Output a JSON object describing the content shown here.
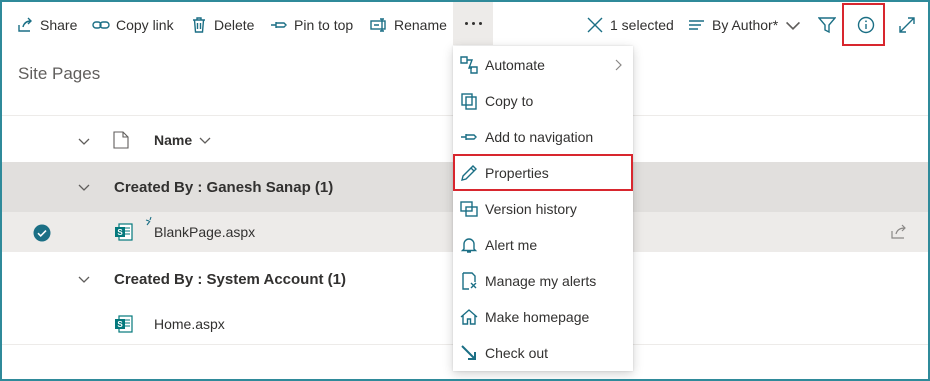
{
  "command_bar": {
    "share": "Share",
    "copy_link": "Copy link",
    "delete": "Delete",
    "pin_to_top": "Pin to top",
    "rename": "Rename",
    "selected": "1 selected",
    "view": "By Author*"
  },
  "page_title": "Site Pages",
  "column": {
    "name": "Name"
  },
  "groups": [
    {
      "title": "Created By : Ganesh Sanap (1)",
      "files": [
        "BlankPage.aspx"
      ]
    },
    {
      "title": "Created By : System Account (1)",
      "files": [
        "Home.aspx"
      ]
    }
  ],
  "context_menu": {
    "items": [
      {
        "label": "Automate",
        "icon": "automate-icon",
        "submenu": true
      },
      {
        "label": "Copy to",
        "icon": "copy-icon"
      },
      {
        "label": "Add to navigation",
        "icon": "pin-icon"
      },
      {
        "label": "Properties",
        "icon": "pencil-icon",
        "highlighted": true
      },
      {
        "label": "Version history",
        "icon": "version-history-icon"
      },
      {
        "label": "Alert me",
        "icon": "bell-icon"
      },
      {
        "label": "Manage my alerts",
        "icon": "manage-alerts-icon"
      },
      {
        "label": "Make homepage",
        "icon": "home-icon"
      },
      {
        "label": "Check out",
        "icon": "check-out-icon"
      }
    ]
  },
  "colors": {
    "accent": "#1b6f85",
    "highlight": "#d8262e",
    "group_header_bg": "#e1dfdd",
    "selected_row_bg": "#edebe9",
    "sharepoint_green": "#03787c"
  }
}
